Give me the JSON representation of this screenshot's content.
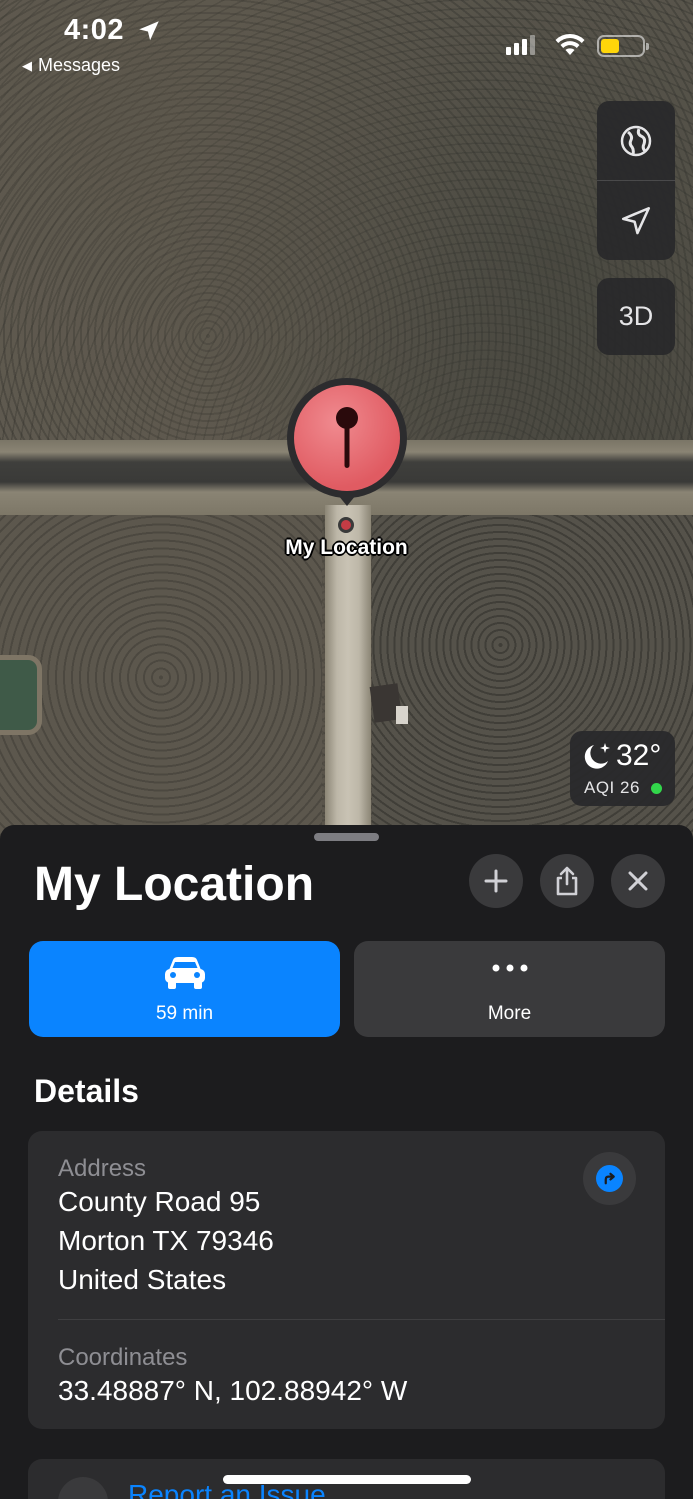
{
  "status_bar": {
    "time": "4:02",
    "back_app": "Messages",
    "icons": [
      "location-arrow-icon",
      "cellular-signal-icon",
      "wifi-icon",
      "battery-icon"
    ],
    "battery_level": 0.45,
    "battery_color": "#ffd60a"
  },
  "map": {
    "controls": {
      "globe_icon": "globe-icon",
      "tracking_icon": "location-arrow-icon",
      "view_3d_label": "3D"
    },
    "pin_label": "My Location",
    "pin_color": "#e05b62",
    "weather": {
      "temperature": "32°",
      "aqi_label": "AQI 26",
      "aqi_status_color": "#32d74b",
      "icon": "moon-stars-icon"
    }
  },
  "sheet": {
    "title": "My Location",
    "buttons": {
      "add_icon": "plus-icon",
      "share_icon": "share-icon",
      "close_icon": "close-icon"
    },
    "actions": [
      {
        "label": "59 min",
        "icon": "car-icon",
        "color": "#0a84ff"
      },
      {
        "label": "More",
        "icon": "ellipsis-icon",
        "color": "#3a3a3c"
      }
    ],
    "details_title": "Details",
    "address": {
      "label": "Address",
      "line1": "County Road 95",
      "line2": "Morton TX 79346",
      "line3": "United States",
      "directions_icon": "directions-arrow-icon"
    },
    "coordinates": {
      "label": "Coordinates",
      "value": "33.48887° N, 102.88942° W"
    },
    "next_item": {
      "text": "Report an Issue",
      "icon": "info-icon"
    }
  }
}
